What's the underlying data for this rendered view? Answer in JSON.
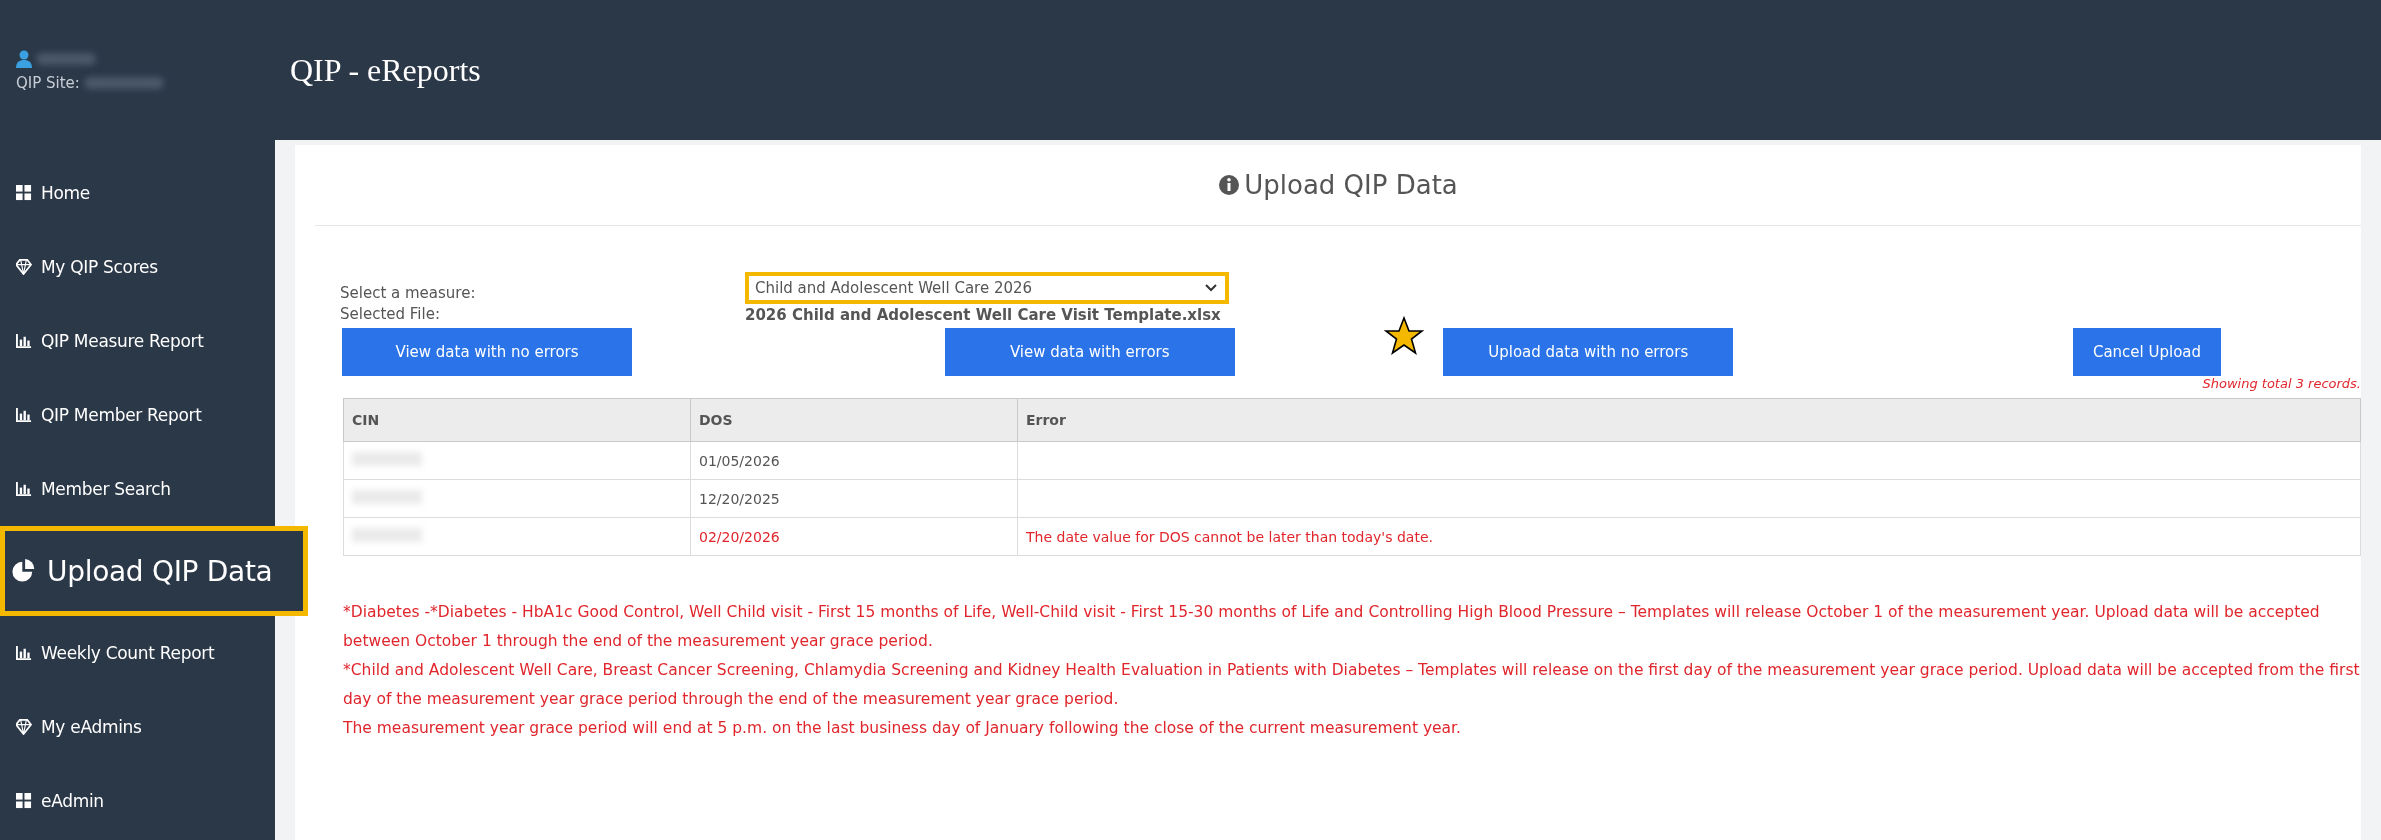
{
  "sidebar": {
    "site_label": "QIP Site:",
    "items": [
      {
        "label": "Home",
        "kind": "grid",
        "selected": false
      },
      {
        "label": "My QIP Scores",
        "kind": "gem",
        "selected": false
      },
      {
        "label": "QIP Measure Report",
        "kind": "chart",
        "selected": false
      },
      {
        "label": "QIP Member Report",
        "kind": "chart",
        "selected": false
      },
      {
        "label": "Member Search",
        "kind": "chart",
        "selected": false
      },
      {
        "label": "Upload QIP Data",
        "kind": "pie",
        "selected": true
      },
      {
        "label": "Weekly Count Report",
        "kind": "chart",
        "selected": false
      },
      {
        "label": "My eAdmins",
        "kind": "gem",
        "selected": false
      },
      {
        "label": "eAdmin",
        "kind": "grid",
        "selected": false
      }
    ]
  },
  "header": {
    "title": "QIP - eReports"
  },
  "page_title": "Upload QIP Data",
  "form": {
    "measure_label": "Select a measure:",
    "measure_value": "Child and Adolescent Well Care 2026",
    "measure_highlighted": true,
    "file_label": "Selected File:",
    "file_name": "2026 Child and Adolescent Well Care Visit Template.xlsx"
  },
  "buttons": [
    {
      "label": "View data with no errors",
      "starred": false
    },
    {
      "label": "View data with errors",
      "starred": false
    },
    {
      "label": "Upload data with no errors",
      "starred": true
    },
    {
      "label": "Cancel Upload",
      "starred": false
    }
  ],
  "records_note": "Showing total 3 records.",
  "table": {
    "columns": [
      "CIN",
      "DOS",
      "Error"
    ],
    "rows": [
      {
        "dos": "01/05/2026",
        "error_text": "",
        "has_error": false
      },
      {
        "dos": "12/20/2025",
        "error_text": "",
        "has_error": false
      },
      {
        "dos": "02/20/2026",
        "error_text": "The date value for DOS cannot be later than today's date.",
        "has_error": true
      }
    ]
  },
  "notes": [
    "*Diabetes -*Diabetes - HbA1c Good Control, Well Child visit - First 15 months of Life, Well-Child visit - First 15-30 months of Life and Controlling High Blood Pressure – Templates will release October 1 of the measurement year. Upload data will be accepted between October 1 through the end of the measurement year grace period.",
    "*Child and Adolescent Well Care, Breast Cancer Screening, Chlamydia Screening and Kidney Health Evaluation in Patients with Diabetes – Templates will release on the first day of the measurement year grace period. Upload data will be accepted from the first day of the measurement year grace period through the end of the measurement year grace period.",
    "The measurement year grace period will end at 5 p.m. on the last business day of January following the close of the current measurement year."
  ]
}
